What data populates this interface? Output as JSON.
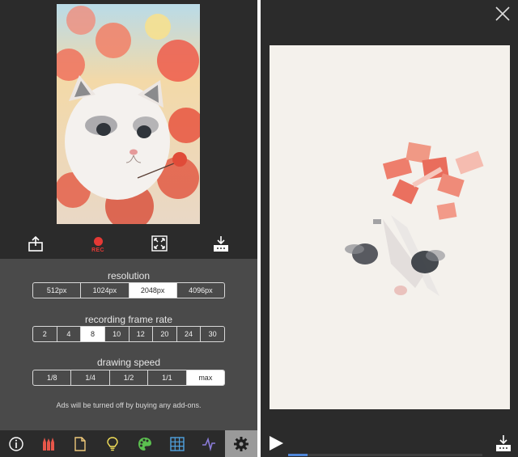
{
  "left_toolbar": {
    "export_icon": "share-icon",
    "rec_label": "REC",
    "fullscreen_icon": "fullscreen-icon",
    "save_icon": "download-icon"
  },
  "settings": {
    "resolution": {
      "title": "resolution",
      "options": [
        "512px",
        "1024px",
        "2048px",
        "4096px"
      ],
      "selected": "2048px"
    },
    "frame_rate": {
      "title": "recording frame rate",
      "options": [
        "2",
        "4",
        "8",
        "10",
        "12",
        "20",
        "24",
        "30"
      ],
      "selected": "8"
    },
    "drawing_speed": {
      "title": "drawing speed",
      "options": [
        "1/8",
        "1/4",
        "1/2",
        "1/1",
        "max"
      ],
      "selected": "max"
    },
    "ads_note": "Ads will be turned off by buying any add-ons."
  },
  "bottom_tabs": [
    {
      "icon": "info-icon"
    },
    {
      "icon": "brushes-icon"
    },
    {
      "icon": "document-icon"
    },
    {
      "icon": "lightbulb-icon"
    },
    {
      "icon": "palette-icon"
    },
    {
      "icon": "grid-icon"
    },
    {
      "icon": "waveform-icon"
    },
    {
      "icon": "gear-icon",
      "active": true
    }
  ],
  "player": {
    "close_icon": "close-icon",
    "play_icon": "play-icon",
    "save_icon": "download-icon",
    "progress": 0.1
  },
  "colors": {
    "rec": "#e53935",
    "panel_bg": "#2b2b2b",
    "settings_bg": "#4a4a4a",
    "progress": "#4f86d9"
  }
}
